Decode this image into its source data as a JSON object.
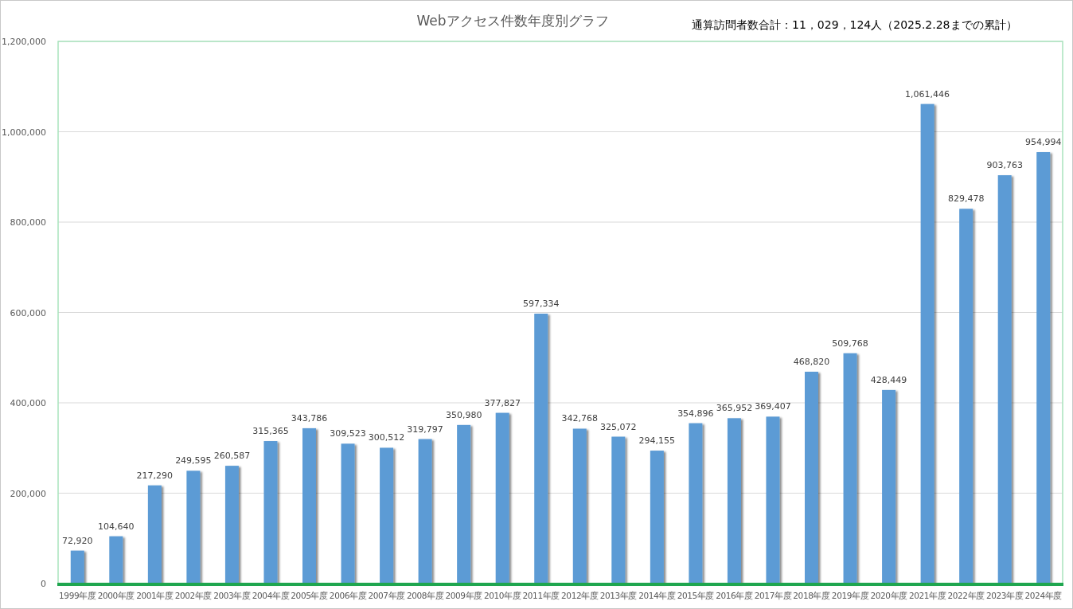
{
  "note": "通算訪問者数合計：11，029，124人（2025.2.28までの累計）",
  "chart_data": {
    "type": "bar",
    "title": "Webアクセス件数年度別グラフ",
    "categories": [
      "1999年度",
      "2000年度",
      "2001年度",
      "2002年度",
      "2003年度",
      "2004年度",
      "2005年度",
      "2006年度",
      "2007年度",
      "2008年度",
      "2009年度",
      "2010年度",
      "2011年度",
      "2012年度",
      "2013年度",
      "2014年度",
      "2015年度",
      "2016年度",
      "2017年度",
      "2018年度",
      "2019年度",
      "2020年度",
      "2021年度",
      "2022年度",
      "2023年度",
      "2024年度"
    ],
    "series": [
      {
        "color": "#5b9bd5",
        "values": [
          72920,
          104640,
          217290,
          249595,
          260587,
          315365,
          343786,
          309523,
          300512,
          319797,
          350980,
          377827,
          597334,
          342768,
          325072,
          294155,
          354896,
          365952,
          369407,
          468820,
          509768,
          428449,
          1061446,
          829478,
          903763,
          954994
        ]
      }
    ],
    "ylim": [
      0,
      1200000
    ],
    "yticks": [
      {
        "value": 0,
        "label": "0"
      },
      {
        "value": 200000,
        "label": "200,000"
      },
      {
        "value": 400000,
        "label": "400,000"
      },
      {
        "value": 600000,
        "label": "600,000"
      },
      {
        "value": 800000,
        "label": "800,000"
      },
      {
        "value": 1000000,
        "label": "1,000,000"
      },
      {
        "value": 1200000,
        "label": "1,200,000"
      }
    ],
    "value_labels": [
      "72,920",
      "104,640",
      "217,290",
      "249,595",
      "260,587",
      "315,365",
      "343,786",
      "309,523",
      "300,512",
      "319,797",
      "350,980",
      "377,827",
      "597,334",
      "342,768",
      "325,072",
      "294,155",
      "354,896",
      "365,952",
      "369,407",
      "468,820",
      "509,768",
      "428,449",
      "1,061,446",
      "829,478",
      "903,763",
      "954,994"
    ],
    "grid": true
  }
}
